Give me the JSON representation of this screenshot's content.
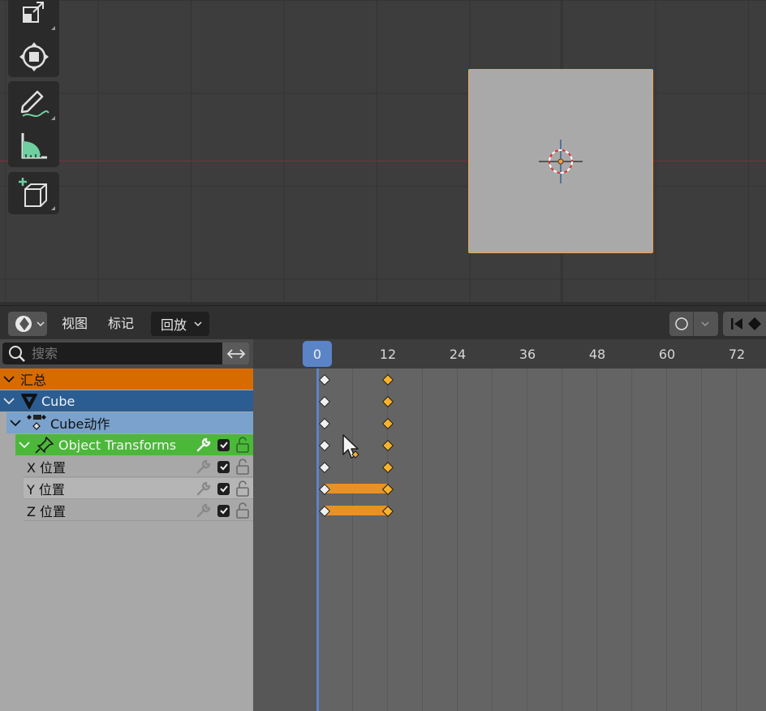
{
  "header": {
    "menu_view": "视图",
    "menu_marker": "标记",
    "menu_playback": "回放"
  },
  "search": {
    "placeholder": "搜索"
  },
  "channels": {
    "summary": "汇总",
    "object": "Cube",
    "action": "Cube动作",
    "group": "Object Transforms",
    "fcurves": [
      "X 位置",
      "Y 位置",
      "Z 位置"
    ]
  },
  "timeline": {
    "current_frame": "0",
    "ticks": [
      "12",
      "24",
      "36",
      "48",
      "60",
      "72"
    ]
  },
  "colors": {
    "summary": "#d76b00",
    "object": "#2b5d93",
    "action": "#7aa2cc",
    "group": "#4cb83a",
    "selected_object": "#f0a04a",
    "key_selected": "#f7b22e",
    "hold_bar": "#e89226",
    "playhead": "#5b84c6"
  },
  "icons": [
    "scale-icon",
    "transform-icon",
    "annotate-icon",
    "measure-icon",
    "add-cube-icon",
    "search-icon",
    "swap-icon",
    "wrench-icon",
    "checkbox-icon",
    "unlock-icon",
    "pin-icon"
  ]
}
